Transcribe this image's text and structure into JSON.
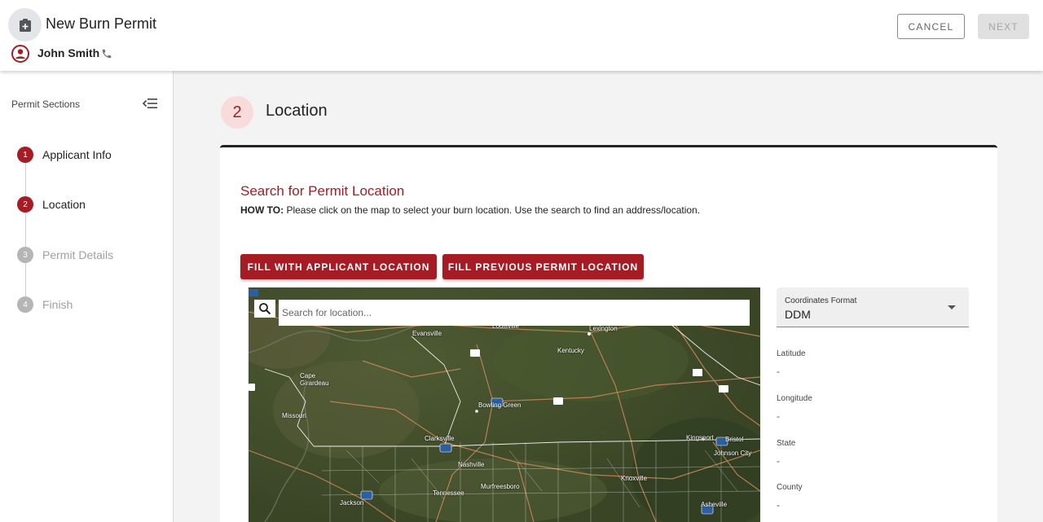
{
  "header": {
    "title": "New Burn Permit",
    "user_name": "John Smith",
    "cancel_label": "CANCEL",
    "next_label": "NEXT"
  },
  "sidebar": {
    "title": "Permit Sections",
    "steps": [
      {
        "num": "1",
        "label": "Applicant Info",
        "state": "active"
      },
      {
        "num": "2",
        "label": "Location",
        "state": "active"
      },
      {
        "num": "3",
        "label": "Permit Details",
        "state": "inactive"
      },
      {
        "num": "4",
        "label": "Finish",
        "state": "inactive"
      }
    ]
  },
  "section": {
    "number": "2",
    "title": "Location"
  },
  "search": {
    "title": "Search for Permit Location",
    "howto_label": "HOW TO:",
    "howto_text": " Please click on the map to select your burn location. Use the search to find an address/location.",
    "fill_applicant_label": "FILL WITH APPLICANT LOCATION",
    "fill_previous_label": "FILL PREVIOUS PERMIT LOCATION",
    "map_placeholder": "Search for location..."
  },
  "map_labels": [
    {
      "text": "Evansville"
    },
    {
      "text": "Louisville"
    },
    {
      "text": "Lexington"
    },
    {
      "text": "Kentucky"
    },
    {
      "text": "Cape"
    },
    {
      "text": "Girardeau"
    },
    {
      "text": "Bowling Green"
    },
    {
      "text": "Missouri"
    },
    {
      "text": "Clarksville"
    },
    {
      "text": "Nashville"
    },
    {
      "text": "Kingsport"
    },
    {
      "text": "Bristol"
    },
    {
      "text": "Johnson City"
    },
    {
      "text": "Knoxville"
    },
    {
      "text": "Murfreesboro"
    },
    {
      "text": "Tennessee"
    },
    {
      "text": "Jackson"
    },
    {
      "text": "Asheville"
    }
  ],
  "coordinates": {
    "format_label": "Coordinates Format",
    "format_value": "DDM",
    "fields": [
      {
        "label": "Latitude",
        "value": "-"
      },
      {
        "label": "Longitude",
        "value": "-"
      },
      {
        "label": "State",
        "value": "-"
      },
      {
        "label": "County",
        "value": "-"
      }
    ]
  },
  "colors": {
    "brand_red": "#a51c24",
    "step_inactive": "#b5b5b5",
    "section_badge_bg": "#f8dcdc"
  },
  "icons": {
    "header": "permit-plus-icon",
    "user": "account-circle-icon",
    "phone": "phone-icon",
    "collapse": "menu-collapse-icon",
    "search": "search-icon",
    "dropdown": "caret-down-icon"
  }
}
